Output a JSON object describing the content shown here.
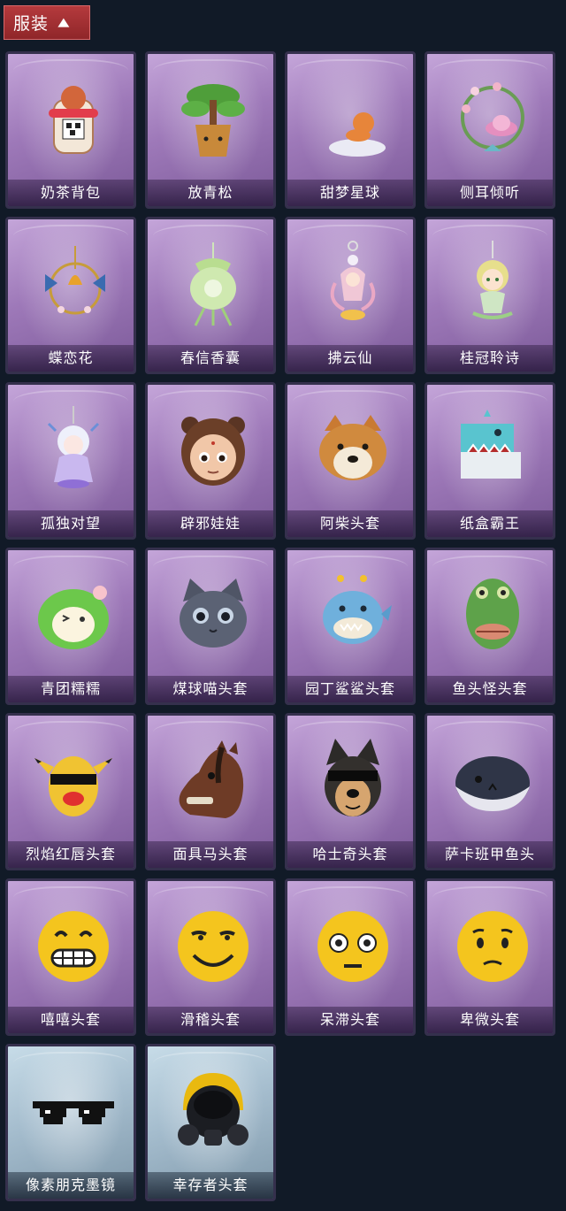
{
  "header": {
    "title": "服装"
  },
  "items": [
    {
      "label": "奶茶背包",
      "icon": "milk-tea-backpack-icon"
    },
    {
      "label": "放青松",
      "icon": "potted-pine-icon"
    },
    {
      "label": "甜梦星球",
      "icon": "moon-fox-icon"
    },
    {
      "label": "侧耳倾听",
      "icon": "lotus-wreath-icon"
    },
    {
      "label": "蝶恋花",
      "icon": "butterfly-bell-icon"
    },
    {
      "label": "春信香囊",
      "icon": "sachet-icon"
    },
    {
      "label": "拂云仙",
      "icon": "fairy-charm-icon"
    },
    {
      "label": "桂冠聆诗",
      "icon": "laurel-doll-icon"
    },
    {
      "label": "孤独对望",
      "icon": "crystal-doll-icon"
    },
    {
      "label": "辟邪娃娃",
      "icon": "doll-head-icon"
    },
    {
      "label": "阿柴头套",
      "icon": "shiba-head-icon"
    },
    {
      "label": "纸盒霸王",
      "icon": "box-dinosaur-icon"
    },
    {
      "label": "青团糯糯",
      "icon": "green-dumpling-icon"
    },
    {
      "label": "煤球喵头套",
      "icon": "cat-head-icon"
    },
    {
      "label": "园丁鲨鲨头套",
      "icon": "shark-head-icon"
    },
    {
      "label": "鱼头怪头套",
      "icon": "fish-head-icon"
    },
    {
      "label": "烈焰红唇头套",
      "icon": "yellow-mask-icon"
    },
    {
      "label": "面具马头套",
      "icon": "horse-head-icon"
    },
    {
      "label": "哈士奇头套",
      "icon": "husky-head-icon"
    },
    {
      "label": "萨卡班甲鱼头",
      "icon": "whale-head-icon"
    },
    {
      "label": "嘻嘻头套",
      "icon": "grin-emoji-icon"
    },
    {
      "label": "滑稽头套",
      "icon": "smirk-emoji-icon"
    },
    {
      "label": "呆滞头套",
      "icon": "stare-emoji-icon"
    },
    {
      "label": "卑微头套",
      "icon": "timid-emoji-icon"
    },
    {
      "label": "像素朋克墨镜",
      "icon": "pixel-sunglasses-icon"
    },
    {
      "label": "幸存者头套",
      "icon": "gas-mask-icon"
    }
  ]
}
